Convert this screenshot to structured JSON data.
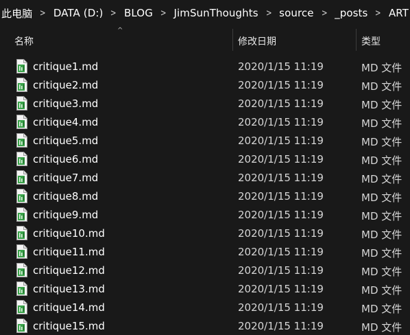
{
  "breadcrumb": {
    "items": [
      "此电脑",
      "DATA (D:)",
      "BLOG",
      "JimSunThoughts",
      "source",
      "_posts",
      "ART"
    ],
    "separator": ">"
  },
  "columns": {
    "name": "名称",
    "date": "修改日期",
    "type": "类型",
    "sort_indicator": "^"
  },
  "files": [
    {
      "name": "critique1.md",
      "date": "2020/1/15 11:19",
      "type": "MD 文件"
    },
    {
      "name": "critique2.md",
      "date": "2020/1/15 11:19",
      "type": "MD 文件"
    },
    {
      "name": "critique3.md",
      "date": "2020/1/15 11:19",
      "type": "MD 文件"
    },
    {
      "name": "critique4.md",
      "date": "2020/1/15 11:19",
      "type": "MD 文件"
    },
    {
      "name": "critique5.md",
      "date": "2020/1/15 11:19",
      "type": "MD 文件"
    },
    {
      "name": "critique6.md",
      "date": "2020/1/15 11:19",
      "type": "MD 文件"
    },
    {
      "name": "critique7.md",
      "date": "2020/1/15 11:19",
      "type": "MD 文件"
    },
    {
      "name": "critique8.md",
      "date": "2020/1/15 11:19",
      "type": "MD 文件"
    },
    {
      "name": "critique9.md",
      "date": "2020/1/15 11:19",
      "type": "MD 文件"
    },
    {
      "name": "critique10.md",
      "date": "2020/1/15 11:19",
      "type": "MD 文件"
    },
    {
      "name": "critique11.md",
      "date": "2020/1/15 11:19",
      "type": "MD 文件"
    },
    {
      "name": "critique12.md",
      "date": "2020/1/15 11:19",
      "type": "MD 文件"
    },
    {
      "name": "critique13.md",
      "date": "2020/1/15 11:19",
      "type": "MD 文件"
    },
    {
      "name": "critique14.md",
      "date": "2020/1/15 11:19",
      "type": "MD 文件"
    },
    {
      "name": "critique15.md",
      "date": "2020/1/15 11:19",
      "type": "MD 文件"
    }
  ],
  "icons": {
    "file": "markdown-file-icon"
  },
  "colors": {
    "background": "#191919",
    "text": "#ffffff",
    "icon_green": "#3aa34a"
  }
}
